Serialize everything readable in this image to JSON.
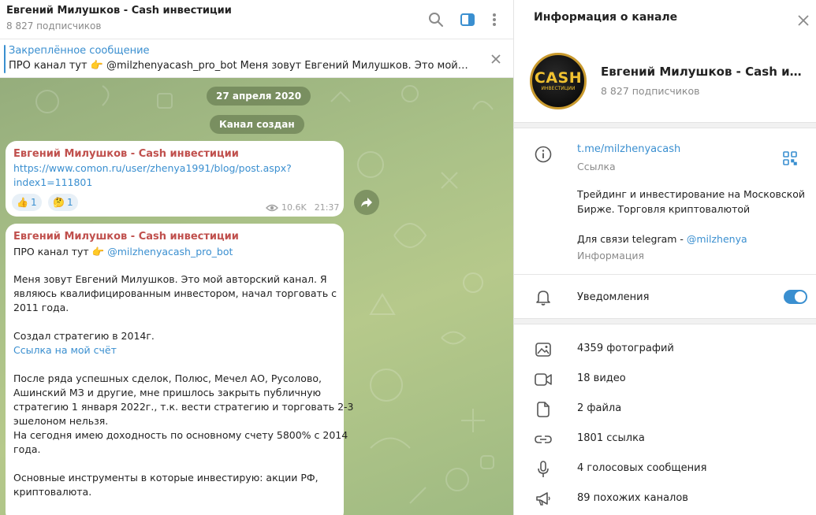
{
  "chat": {
    "title": "Евгений Милушков - Cash инвестиции",
    "subscribers": "8 827 подписчиков",
    "pinned": {
      "title": "Закреплённое сообщение",
      "text": "ПРО канал тут 👉 @milzhenyacash_pro_bot  Меня зовут Евгений Милушков. Это мой авторский канал. Я являюсь квалифицированным инвестором"
    },
    "date_pill": "27 апреля 2020",
    "created_pill": "Канал создан",
    "messages": [
      {
        "sender": "Евгений Милушков - Cash инвестиции",
        "link_line1": "https://www.comon.ru/user/zhenya1991/blog/post.aspx?",
        "link_line2": "index1=111801",
        "reactions": [
          {
            "emoji": "👍",
            "count": "1"
          },
          {
            "emoji": "🤔",
            "count": "1"
          }
        ],
        "views": "10.6K",
        "time": "21:37"
      },
      {
        "sender": "Евгений Милушков - Cash инвестиции",
        "pro_prefix": "ПРО канал тут 👉 ",
        "pro_link": "@milzhenyacash_pro_bot",
        "para1": [
          "Меня зовут Евгений Милушков. Это мой авторский канал. Я",
          "являюсь квалифицированным инвестором, начал торговать с",
          "2011 года."
        ],
        "para2": "Создал стратегию в 2014г.",
        "account_link": "Ссылка на мой счёт",
        "para3": [
          "После ряда успешных сделок, Полюс, Мечел АО, Русолово,",
          "Ашинский МЗ и другие, мне пришлось закрыть публичную",
          "стратегию 1 января 2022г., т.к. вести стратегию и торговать 2-3",
          "эшелоном нельзя.",
          "На сегодня имею доходность по основному счету 5800% с 2014",
          "года."
        ],
        "para4": [
          "Основные инструменты в которые инвестирую: акции РФ,",
          "криптовалюта."
        ]
      }
    ]
  },
  "info": {
    "title": "Информация о канале",
    "channel_name": "Евгений Милушков - Cash инвестиции",
    "subscribers": "8 827 подписчиков",
    "avatar_text": "CASH",
    "avatar_subtext": "ИНВЕСТИЦИИ",
    "link": "t.me/milzhenyacash",
    "link_caption": "Ссылка",
    "description": [
      "Трейдинг и инвестирование на Московской",
      "Бирже. Торговля криптовалютой"
    ],
    "contact_prefix": "Для связи telegram - ",
    "contact_link": "@milzhenya",
    "description_caption": "Информация",
    "notifications_label": "Уведомления",
    "notifications_on": true,
    "media": [
      {
        "icon": "photo-icon",
        "label": "4359 фотографий"
      },
      {
        "icon": "video-icon",
        "label": "18 видео"
      },
      {
        "icon": "file-icon",
        "label": "2 файла"
      },
      {
        "icon": "link-icon",
        "label": "1801 ссылка"
      },
      {
        "icon": "microphone-icon",
        "label": "4 голосовых сообщения"
      },
      {
        "icon": "megaphone-icon",
        "label": "89 похожих каналов"
      }
    ]
  },
  "colors": {
    "accent": "#3a8fd0",
    "sender": "#c0504d",
    "chat_bg": "#a9c087"
  }
}
